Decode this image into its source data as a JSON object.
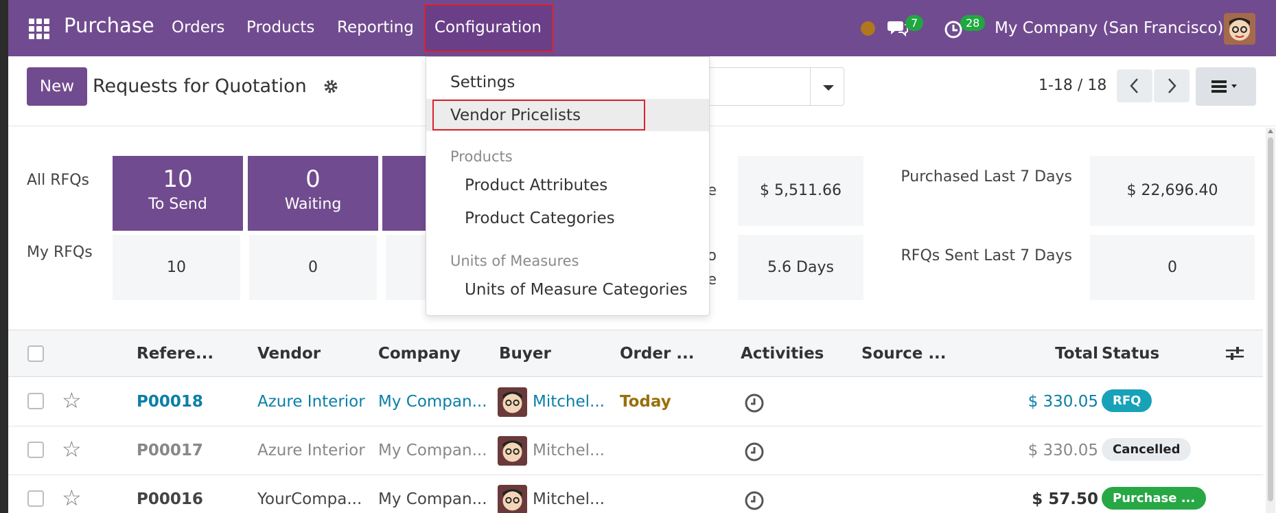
{
  "nav": {
    "app_name": "Purchase",
    "menus": [
      "Orders",
      "Products",
      "Reporting",
      "Configuration"
    ],
    "chat_badge": "7",
    "activity_badge": "28",
    "company": "My Company (San Francisco)"
  },
  "control": {
    "new_label": "New",
    "title": "Requests for Quotation",
    "pager": "1-18 / 18"
  },
  "dashboard": {
    "all_rfqs_label": "All RFQs",
    "my_rfqs_label": "My RFQs",
    "tiles": [
      {
        "value": "10",
        "label": "To Send"
      },
      {
        "value": "0",
        "label": "Waiting"
      }
    ],
    "my_tiles": [
      "10",
      "0"
    ],
    "partial_label_1": "e",
    "partial_label_2": "o",
    "partial_label_3": "e",
    "stat_value_1": "$ 5,511.66",
    "stat_value_2": "5.6 Days",
    "stat_label_3": "Purchased Last 7 Days",
    "stat_value_3": "$ 22,696.40",
    "stat_label_4": "RFQs Sent Last 7 Days",
    "stat_value_4": "0"
  },
  "dropdown": {
    "settings": "Settings",
    "vendor_pricelists": "Vendor Pricelists",
    "products_header": "Products",
    "product_attributes": "Product Attributes",
    "product_categories": "Product Categories",
    "uom_header": "Units of Measures",
    "uom_categories": "Units of Measure Categories"
  },
  "table": {
    "columns": [
      "Refere...",
      "Vendor",
      "Company",
      "Buyer",
      "Order ...",
      "Activities",
      "Source ...",
      "Total",
      "Status"
    ],
    "rows": [
      {
        "ref": "P00018",
        "vendor": "Azure Interior",
        "company": "My Compan...",
        "buyer": "Mitchel...",
        "order": "Today",
        "total": "$ 330.05",
        "status": "RFQ"
      },
      {
        "ref": "P00017",
        "vendor": "Azure Interior",
        "company": "My Compan...",
        "buyer": "Mitchel...",
        "order": "",
        "total": "$ 330.05",
        "status": "Cancelled"
      },
      {
        "ref": "P00016",
        "vendor": "YourCompa...",
        "company": "My Compan...",
        "buyer": "Mitchel...",
        "order": "",
        "total": "$ 57.50",
        "status": "Purchase ..."
      }
    ]
  },
  "colors": {
    "brand": "#714b8f",
    "highlight_border": "#d9232e",
    "link": "#0b7fa6",
    "status_rfq": "#17a2b8",
    "status_purchase": "#28a745"
  }
}
